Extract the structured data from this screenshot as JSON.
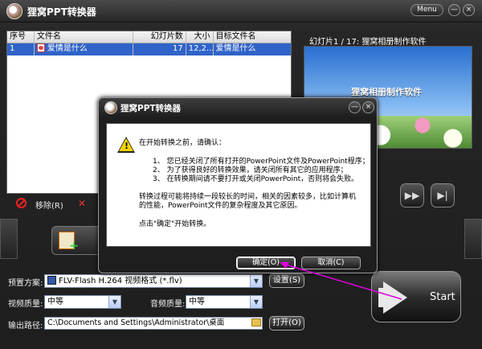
{
  "app": {
    "title": "狸窝PPT转换器",
    "menu_label": "Menu",
    "min_glyph": "—",
    "close_glyph": "×"
  },
  "table": {
    "headers": [
      "序号",
      "文件名",
      "幻灯片数",
      "大小",
      "目标文件名"
    ],
    "rows": [
      {
        "index": "1",
        "filename": "爱情是什么",
        "slides": "17",
        "size": "12,2...",
        "target": "爱情是什么"
      }
    ]
  },
  "toolbar": {
    "remove_label": "移除(R)"
  },
  "preview": {
    "header": "幻灯片1 / 17: 狸窝相册制作软件",
    "slide_title": "狸窝相册制作软件",
    "fast_forward_glyph": "▶▶",
    "next_glyph": "▶|"
  },
  "settings": {
    "preset_label": "预置方案:",
    "preset_value": "FLV-Flash H.264 视频格式 (*.flv)",
    "settings_button": "设置(S)",
    "video_quality_label": "视频质量:",
    "video_quality_value": "中等",
    "audio_quality_label": "音频质量:",
    "audio_quality_value": "中等",
    "output_label": "输出路径:",
    "output_path": "C:\\Documents and Settings\\Administrator\\桌面",
    "open_button": "打开(O)",
    "start_label": "Start",
    "dropdown_glyph": "▼"
  },
  "dialog": {
    "title": "狸窝PPT转换器",
    "intro": "在开始转换之前，请确认：",
    "items": [
      "1、 您已经关闭了所有打开的PowerPoint文件及PowerPoint程序；",
      "2、 为了获得良好的转换效果，请关闭所有其它的应用程序；",
      "3、 在转换期间请不要打开或关闭PowerPoint，否则将会失败。"
    ],
    "note_line1": "转换过程可能将持续一段较长的时间，相关的因素较多，比如计算机",
    "note_line2": "的性能，PowerPoint文件的复杂程度及其它原因。",
    "prompt": "点击\"确定\"开始转换。",
    "ok_button": "确定(O)",
    "cancel_button": "取消(C)",
    "min_glyph": "—",
    "close_glyph": "×"
  },
  "colors": {
    "selection": "#2f63c8",
    "pointer": "#e000e0",
    "warning": "#f5d300"
  }
}
